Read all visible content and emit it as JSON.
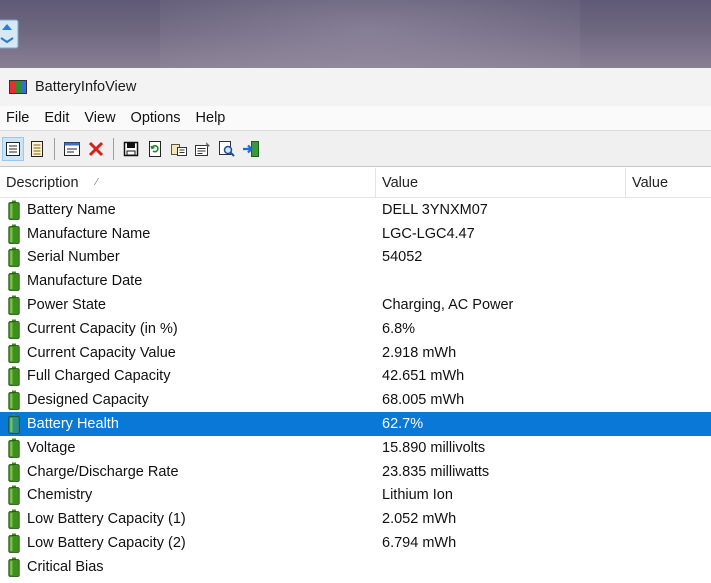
{
  "window": {
    "title": "BatteryInfoView"
  },
  "menu": [
    "File",
    "Edit",
    "View",
    "Options",
    "Help"
  ],
  "toolbar_icons": [
    "view-properties-icon",
    "view-log-icon",
    "html-report-icon",
    "delete-icon",
    "save-icon",
    "refresh-icon",
    "copy-icon",
    "properties-icon",
    "find-icon",
    "exit-icon"
  ],
  "columns": {
    "description": "Description",
    "value": "Value",
    "value2": "Value"
  },
  "rows": [
    {
      "description": "Battery Name",
      "value": "DELL 3YNXM07"
    },
    {
      "description": "Manufacture Name",
      "value": "LGC-LGC4.47"
    },
    {
      "description": "Serial Number",
      "value": "54052"
    },
    {
      "description": "Manufacture Date",
      "value": ""
    },
    {
      "description": "Power State",
      "value": "Charging, AC Power"
    },
    {
      "description": "Current Capacity (in %)",
      "value": "6.8%"
    },
    {
      "description": "Current Capacity Value",
      "value": "2.918 mWh"
    },
    {
      "description": "Full Charged Capacity",
      "value": "42.651 mWh"
    },
    {
      "description": "Designed Capacity",
      "value": "68.005 mWh"
    },
    {
      "description": "Battery Health",
      "value": "62.7%",
      "selected": true
    },
    {
      "description": "Voltage",
      "value": "15.890 millivolts"
    },
    {
      "description": "Charge/Discharge Rate",
      "value": "23.835 milliwatts"
    },
    {
      "description": "Chemistry",
      "value": "Lithium Ion"
    },
    {
      "description": "Low Battery Capacity (1)",
      "value": "2.052 mWh"
    },
    {
      "description": "Low Battery Capacity (2)",
      "value": "6.794 mWh"
    },
    {
      "description": "Critical Bias",
      "value": ""
    }
  ],
  "colors": {
    "selection": "#0a78d7",
    "battery_green": "#3f8f1e",
    "toolbar_bg": "#f0f0f0"
  }
}
